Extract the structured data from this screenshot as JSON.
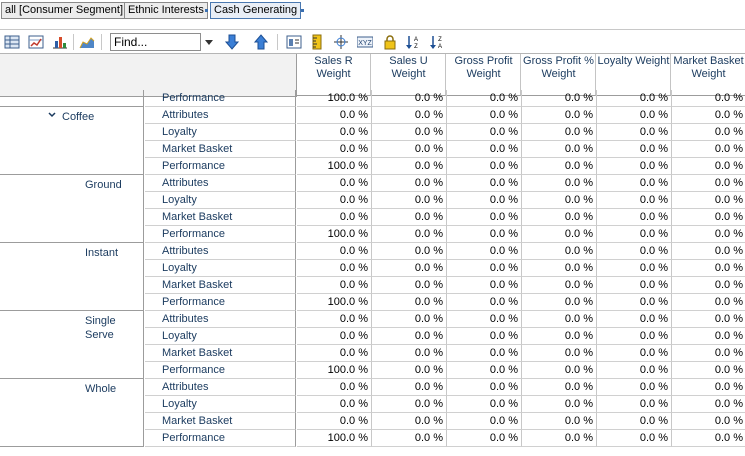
{
  "breadcrumbs": [
    {
      "label": "all [Consumer Segment]"
    },
    {
      "label": "Ethnic Interests"
    },
    {
      "label": "Cash Generating"
    }
  ],
  "toolbar": {
    "find_placeholder": "Find...",
    "icons": [
      "grid-view-icon",
      "chart-grid-icon",
      "bar-chart-icon",
      "area-chart-icon",
      "dropdown-arrow-icon",
      "arrow-down-icon",
      "arrow-up-icon",
      "layout-icon",
      "ruler-icon",
      "crosshair-icon",
      "xyz-icon",
      "lock-icon",
      "sort-ascending-icon",
      "sort-descending-icon"
    ]
  },
  "columns": [
    {
      "label": "Sales R Weight"
    },
    {
      "label": "Sales U Weight"
    },
    {
      "label": "Gross Profit Weight"
    },
    {
      "label": "Gross Profit % Weight"
    },
    {
      "label": "Loyalty Weight"
    },
    {
      "label": "Market Basket Weight"
    }
  ],
  "rows": [
    {
      "group": "",
      "metric": "Performance",
      "values": [
        "100.0 %",
        "0.0 %",
        "0.0 %",
        "0.0 %",
        "0.0 %",
        "0.0 %"
      ]
    },
    {
      "group": "Coffee",
      "metric": "Attributes",
      "values": [
        "0.0 %",
        "0.0 %",
        "0.0 %",
        "0.0 %",
        "0.0 %",
        "0.0 %"
      ]
    },
    {
      "group": "Coffee",
      "metric": "Loyalty",
      "values": [
        "0.0 %",
        "0.0 %",
        "0.0 %",
        "0.0 %",
        "0.0 %",
        "0.0 %"
      ]
    },
    {
      "group": "Coffee",
      "metric": "Market Basket",
      "values": [
        "0.0 %",
        "0.0 %",
        "0.0 %",
        "0.0 %",
        "0.0 %",
        "0.0 %"
      ]
    },
    {
      "group": "Coffee",
      "metric": "Performance",
      "values": [
        "100.0 %",
        "0.0 %",
        "0.0 %",
        "0.0 %",
        "0.0 %",
        "0.0 %"
      ]
    },
    {
      "group": "Ground",
      "metric": "Attributes",
      "values": [
        "0.0 %",
        "0.0 %",
        "0.0 %",
        "0.0 %",
        "0.0 %",
        "0.0 %"
      ]
    },
    {
      "group": "Ground",
      "metric": "Loyalty",
      "values": [
        "0.0 %",
        "0.0 %",
        "0.0 %",
        "0.0 %",
        "0.0 %",
        "0.0 %"
      ]
    },
    {
      "group": "Ground",
      "metric": "Market Basket",
      "values": [
        "0.0 %",
        "0.0 %",
        "0.0 %",
        "0.0 %",
        "0.0 %",
        "0.0 %"
      ]
    },
    {
      "group": "Ground",
      "metric": "Performance",
      "values": [
        "100.0 %",
        "0.0 %",
        "0.0 %",
        "0.0 %",
        "0.0 %",
        "0.0 %"
      ]
    },
    {
      "group": "Instant",
      "metric": "Attributes",
      "values": [
        "0.0 %",
        "0.0 %",
        "0.0 %",
        "0.0 %",
        "0.0 %",
        "0.0 %"
      ]
    },
    {
      "group": "Instant",
      "metric": "Loyalty",
      "values": [
        "0.0 %",
        "0.0 %",
        "0.0 %",
        "0.0 %",
        "0.0 %",
        "0.0 %"
      ]
    },
    {
      "group": "Instant",
      "metric": "Market Basket",
      "values": [
        "0.0 %",
        "0.0 %",
        "0.0 %",
        "0.0 %",
        "0.0 %",
        "0.0 %"
      ]
    },
    {
      "group": "Instant",
      "metric": "Performance",
      "values": [
        "100.0 %",
        "0.0 %",
        "0.0 %",
        "0.0 %",
        "0.0 %",
        "0.0 %"
      ]
    },
    {
      "group": "Single Serve",
      "metric": "Attributes",
      "values": [
        "0.0 %",
        "0.0 %",
        "0.0 %",
        "0.0 %",
        "0.0 %",
        "0.0 %"
      ]
    },
    {
      "group": "Single Serve",
      "metric": "Loyalty",
      "values": [
        "0.0 %",
        "0.0 %",
        "0.0 %",
        "0.0 %",
        "0.0 %",
        "0.0 %"
      ]
    },
    {
      "group": "Single Serve",
      "metric": "Market Basket",
      "values": [
        "0.0 %",
        "0.0 %",
        "0.0 %",
        "0.0 %",
        "0.0 %",
        "0.0 %"
      ]
    },
    {
      "group": "Single Serve",
      "metric": "Performance",
      "values": [
        "100.0 %",
        "0.0 %",
        "0.0 %",
        "0.0 %",
        "0.0 %",
        "0.0 %"
      ]
    },
    {
      "group": "Whole",
      "metric": "Attributes",
      "values": [
        "0.0 %",
        "0.0 %",
        "0.0 %",
        "0.0 %",
        "0.0 %",
        "0.0 %"
      ]
    },
    {
      "group": "Whole",
      "metric": "Loyalty",
      "values": [
        "0.0 %",
        "0.0 %",
        "0.0 %",
        "0.0 %",
        "0.0 %",
        "0.0 %"
      ]
    },
    {
      "group": "Whole",
      "metric": "Market Basket",
      "values": [
        "0.0 %",
        "0.0 %",
        "0.0 %",
        "0.0 %",
        "0.0 %",
        "0.0 %"
      ]
    },
    {
      "group": "Whole",
      "metric": "Performance",
      "values": [
        "100.0 %",
        "0.0 %",
        "0.0 %",
        "0.0 %",
        "0.0 %",
        "0.0 %"
      ]
    }
  ],
  "groups": [
    {
      "label": "",
      "expanded": false
    },
    {
      "label": "Coffee",
      "expanded": true
    },
    {
      "label": "Ground",
      "expanded": false
    },
    {
      "label": "Instant",
      "expanded": false
    },
    {
      "label": "Single Serve",
      "expanded": false
    },
    {
      "label": "Whole",
      "expanded": false
    }
  ],
  "colors": {
    "header_text": "#1a3a5e",
    "accent": "#3a6fb0"
  }
}
